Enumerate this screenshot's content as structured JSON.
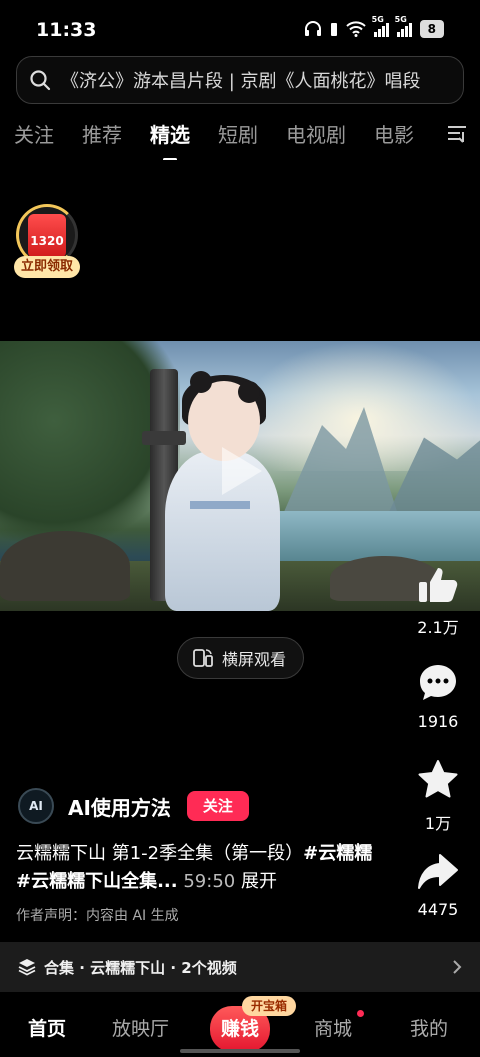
{
  "status": {
    "time": "11:33",
    "network1": "5G",
    "network2": "5G",
    "battery": "8",
    "colors": {
      "battery_bg": "#dddddd"
    }
  },
  "search": {
    "text": "《济公》游本昌片段 | 京剧《人面桃花》唱段",
    "icon": "search-icon"
  },
  "tabs": [
    {
      "label": "关注",
      "active": false
    },
    {
      "label": "推荐",
      "active": false
    },
    {
      "label": "精选",
      "active": true
    },
    {
      "label": "短剧",
      "active": false
    },
    {
      "label": "电视剧",
      "active": false
    },
    {
      "label": "电影",
      "active": false
    }
  ],
  "red_packet": {
    "amount": "1320",
    "button": "立即领取"
  },
  "video": {
    "landscape_label": "横屏观看"
  },
  "actions": {
    "likes": "2.1万",
    "comments": "1916",
    "favorites": "1万",
    "shares": "4475"
  },
  "author": {
    "avatar_text": "AI",
    "name": "AI使用方法",
    "follow": "关注"
  },
  "description": {
    "line_text": "云糯糯下山 第1-2季全集（第一段）",
    "tag1": "#云糯糯",
    "tag2": "#云糯糯下山全集...",
    "duration": "59:50",
    "expand": "展开",
    "notice": "作者声明：内容由 AI 生成"
  },
  "collection": {
    "label": "合集 · 云糯糯下山 · 2个视频"
  },
  "bottom_nav": {
    "home": "首页",
    "theater": "放映厅",
    "earn": "赚钱",
    "earn_badge": "开宝箱",
    "mall": "商城",
    "me": "我的"
  },
  "colors": {
    "accent": "#ff2b55",
    "background": "#000000"
  }
}
